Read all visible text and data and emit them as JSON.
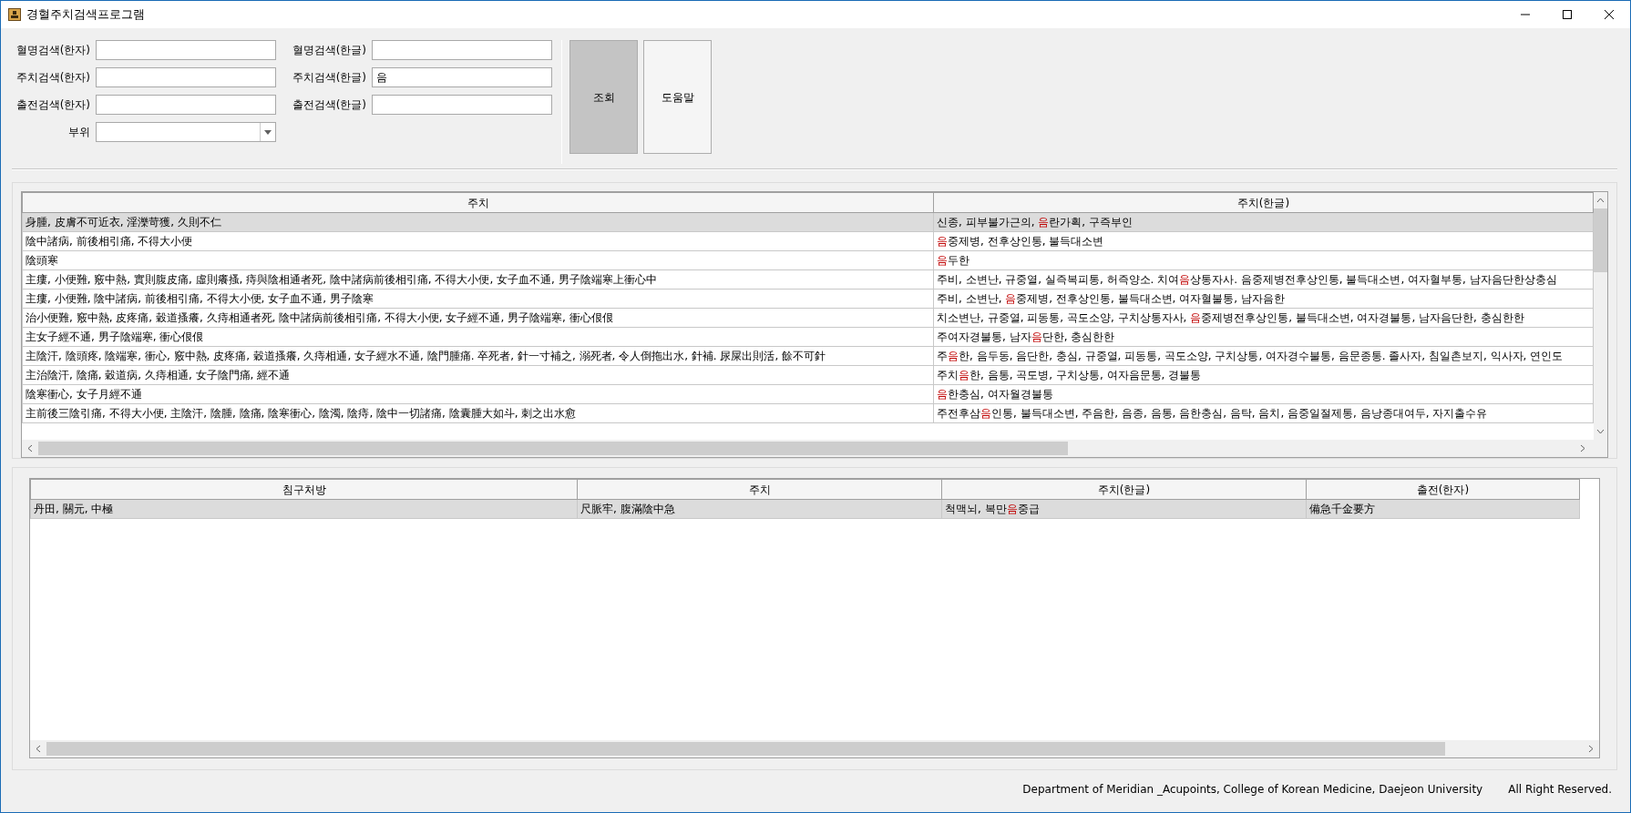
{
  "window": {
    "title": "경혈주치검색프로그램"
  },
  "search_form": {
    "fields": [
      {
        "label": "혈명검색(한자)"
      },
      {
        "label": "혈명검색(한글)"
      },
      {
        "label": "주치검색(한자)"
      },
      {
        "label": "주치검색(한글)",
        "value": "음"
      },
      {
        "label": "출전검색(한자)"
      },
      {
        "label": "출전검색(한글)"
      }
    ],
    "part_select": {
      "label": "부위"
    },
    "buttons": [
      {
        "label": "조회",
        "pressed": true
      },
      {
        "label": "도움말",
        "pressed": false
      }
    ]
  },
  "symptom_table": {
    "columns": [
      "주치",
      "주치(한글)"
    ],
    "rows": [
      {
        "selected": true,
        "hanja": "身腫, 皮膚不可近衣, 淫濼苛獲, 久則不仁",
        "korean": [
          {
            "text": "신종, 피부불가근의, ",
            "highlight": false
          },
          {
            "text": "음",
            "highlight": true
          },
          {
            "text": "란가획, 구즉부인",
            "highlight": false
          }
        ]
      },
      {
        "selected": false,
        "hanja": "陰中諸病, 前後相引痛, 不得大小便",
        "korean": [
          {
            "text": "음",
            "highlight": true
          },
          {
            "text": "중제병, 전후상인통, 불득대소변",
            "highlight": false
          }
        ]
      },
      {
        "selected": false,
        "hanja": "陰頭寒",
        "korean": [
          {
            "text": "음",
            "highlight": true
          },
          {
            "text": "두한",
            "highlight": false
          }
        ]
      },
      {
        "selected": false,
        "hanja": "主瘻, 小便難, 竅中熱, 實則腹皮痛, 虛則癢搔, 痔與陰相通者死, 陰中諸病前後相引痛, 不得大小便, 女子血不通, 男子陰端寒上衝心中",
        "korean": [
          {
            "text": "주비, 소변난, 규중열, 실즉복피통, 허즉양소. 치여",
            "highlight": false
          },
          {
            "text": "음",
            "highlight": true
          },
          {
            "text": "상통자사. 음중제병전후상인통, 불득대소변, 여자혈부통, 남자음단한상충심",
            "highlight": false
          }
        ]
      },
      {
        "selected": false,
        "hanja": "主瘻, 小便難, 陰中諸病, 前後相引痛, 不得大小便, 女子血不通, 男子陰寒",
        "korean": [
          {
            "text": "주비, 소변난, ",
            "highlight": false
          },
          {
            "text": "음",
            "highlight": true
          },
          {
            "text": "중제병, 전후상인통, 불득대소변, 여자혈불통, 남자음한",
            "highlight": false
          }
        ]
      },
      {
        "selected": false,
        "hanja": "治小便難, 竅中熱, 皮疼痛, 穀道搔癢, 久痔相通者死, 陰中諸病前後相引痛, 不得大小便, 女子經不通, 男子陰端寒, 衝心佷佷",
        "korean": [
          {
            "text": "치소변난, 규중열, 피동통, 곡도소양, 구치상통자사, ",
            "highlight": false
          },
          {
            "text": "음",
            "highlight": true
          },
          {
            "text": "중제병전후상인통, 불득대소변, 여자경불통, 남자음단한, 충심한한",
            "highlight": false
          }
        ]
      },
      {
        "selected": false,
        "hanja": "主女子經不通, 男子陰端寒, 衝心佷佷",
        "korean": [
          {
            "text": "주여자경불통, 남자",
            "highlight": false
          },
          {
            "text": "음",
            "highlight": true
          },
          {
            "text": "단한, 충심한한",
            "highlight": false
          }
        ]
      },
      {
        "selected": false,
        "hanja": "主陰汗, 陰頭疼, 陰端寒, 衝心, 竅中熱, 皮疼痛, 穀道搔癢, 久痔相通, 女子經水不通, 陰門腫痛. 卒死者, 針一寸補之, 溺死者, 令人倒拖出水, 針補. 尿屎出則活, 餘不可針",
        "korean": [
          {
            "text": "주",
            "highlight": false
          },
          {
            "text": "음",
            "highlight": true
          },
          {
            "text": "한, 음두동, 음단한, 충심, 규중열, 피동통, 곡도소양, 구치상통, 여자경수불통, 음문종통. 졸사자, 침일촌보지, 익사자, 연인도",
            "highlight": false
          }
        ]
      },
      {
        "selected": false,
        "hanja": "主治陰汗, 陰痛, 穀道病, 久痔相通, 女子陰門痛, 經不通",
        "korean": [
          {
            "text": "주치",
            "highlight": false
          },
          {
            "text": "음",
            "highlight": true
          },
          {
            "text": "한, 음통, 곡도병, 구치상통, 여자음문통, 경불통",
            "highlight": false
          }
        ]
      },
      {
        "selected": false,
        "hanja": "陰寒衝心, 女子月經不通",
        "korean": [
          {
            "text": "음",
            "highlight": true
          },
          {
            "text": "한충심, 여자월경불통",
            "highlight": false
          }
        ]
      },
      {
        "selected": false,
        "hanja": "主前後三陰引痛, 不得大小便, 主陰汗, 陰腫, 陰痛, 陰寒衝心, 陰濁, 陰痔, 陰中一切諸痛, 陰囊腫大如斗, 刺之出水愈",
        "korean": [
          {
            "text": "주전후삼",
            "highlight": false
          },
          {
            "text": "음",
            "highlight": true
          },
          {
            "text": "인통, 불득대소변, 주음한, 음종, 음통, 음한충심, 음탁, 음치, 음중일절제통, 음낭종대여두, 자지출수유",
            "highlight": false
          }
        ]
      }
    ]
  },
  "prescription_table": {
    "columns": [
      "침구처방",
      "주치",
      "주치(한글)",
      "출전(한자)"
    ],
    "rows": [
      {
        "selected": true,
        "prescription": "丹田, 關元, 中極",
        "symptom": "尺脈牢, 腹滿陰中急",
        "symptom_korean": [
          {
            "text": "척맥뇌, 복만",
            "highlight": false
          },
          {
            "text": "음",
            "highlight": true
          },
          {
            "text": "중급",
            "highlight": false
          }
        ],
        "source": "備急千金要方"
      }
    ]
  },
  "footer": {
    "credit": "Department of Meridian _Acupoints, College of Korean Medicine, Daejeon University",
    "rights": "All Right Reserved."
  }
}
